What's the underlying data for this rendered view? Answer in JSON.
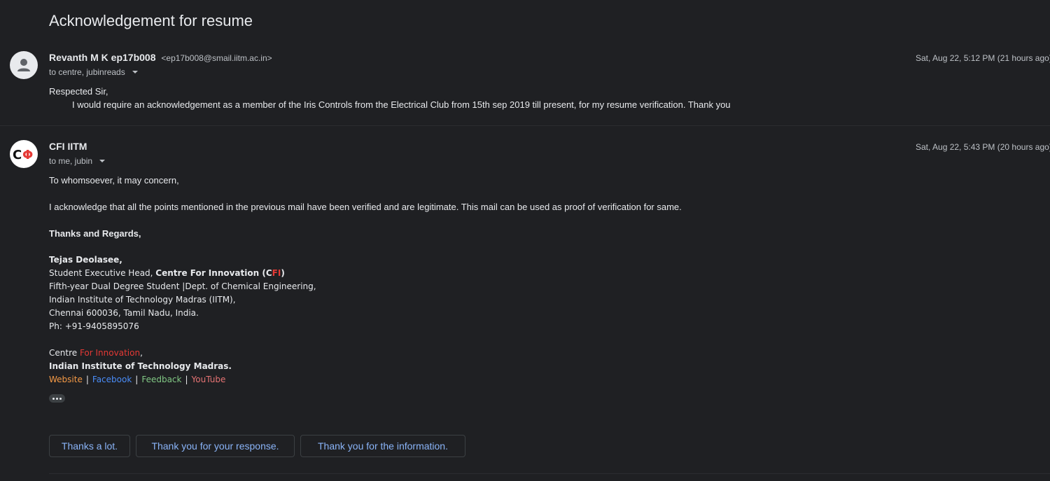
{
  "subject": "Acknowledgement for resume",
  "messages": [
    {
      "sender_name": "Revanth M K ep17b008",
      "sender_email": "<ep17b008@smail.iitm.ac.in>",
      "recipients": "to centre, jubinreads",
      "timestamp": "Sat, Aug 22, 5:12 PM (21 hours ago)",
      "body": [
        "Respected Sir,",
        "I would require an acknowledgement as a member of the Iris Controls from the Electrical Club from 15th sep 2019 till present, for my resume verification. Thank you"
      ]
    },
    {
      "sender_name": "CFI IITM",
      "avatar_text": "CΦ",
      "recipients": "to me, jubin",
      "timestamp": "Sat, Aug 22, 5:43 PM (20 hours ago)",
      "body": [
        "To whomsoever, it may concern,",
        "I acknowledge that all the points mentioned in the previous mail have been verified and are legitimate. This mail can be used as proof of verification for same.",
        "Thanks and Regards,"
      ],
      "signature": {
        "name": "Tejas Deolasee,",
        "role_prefix": "Student Executive Head, ",
        "role_org": "Centre For Innovation (C",
        "role_fi": "FI",
        "role_close": ")",
        "student_line_a": "Fifth-year Dual Degree Student |",
        "student_line_b": "Dept. of Chemical Engineering,",
        "institute": "Indian Institute of Technology Madras (IITM),",
        "address": "Chennai 600036, Tamil Nadu, India.",
        "phone": "Ph: +91-9405895076",
        "centre_a": "Centre ",
        "centre_b": "For Innovation",
        "centre_c": ",",
        "institute2": "Indian Institute of Technology Madras.",
        "links": [
          "Website",
          "Facebook",
          "Feedback",
          "YouTube"
        ],
        "link_sep": "|"
      }
    }
  ],
  "smart_replies": [
    "Thanks a lot.",
    "Thank you for your response.",
    "Thank you for the information."
  ],
  "icons": {
    "avatar_generic": "person-icon",
    "more": "ellipsis-icon",
    "dropdown": "chevron-down-icon"
  },
  "colors": {
    "background": "#1f2023",
    "link": "#8ab4f8",
    "cfi_red": "#e53935"
  }
}
